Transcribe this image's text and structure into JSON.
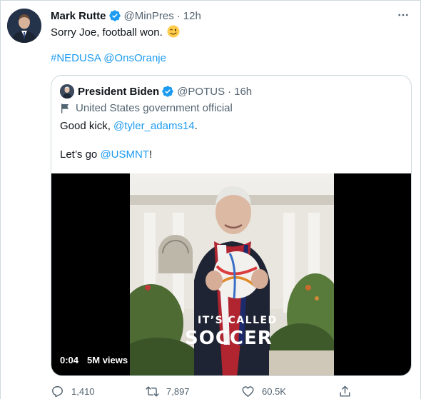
{
  "tweet": {
    "author_name": "Mark Rutte",
    "author_handle": "@MinPres",
    "separator": "·",
    "time": "12h",
    "text": "Sorry Joe, football won.",
    "emoji_icon": "winking-face-emoji",
    "hashtag": "#NEDUSA",
    "mention": "@OnsOranje"
  },
  "quote": {
    "author_name": "President Biden",
    "author_handle": "@POTUS",
    "separator": "·",
    "time": "16h",
    "label": "United States government official",
    "text_prefix": "Good kick, ",
    "text_mention": "@tyler_adams14",
    "text_suffix": ".",
    "text2_prefix": "Let’s go ",
    "text2_mention": "@USMNT",
    "text2_suffix": "!",
    "video": {
      "caption_small": "IT’S CALLED",
      "caption_big": "SOCCER",
      "duration": "0:04",
      "views": "5M views"
    }
  },
  "actions": {
    "replies": "1,410",
    "retweets": "7,897",
    "likes": "60.5K"
  },
  "colors": {
    "accent": "#1d9bf0",
    "text": "#0f1419",
    "muted": "#536471",
    "border": "#cfd9de"
  }
}
